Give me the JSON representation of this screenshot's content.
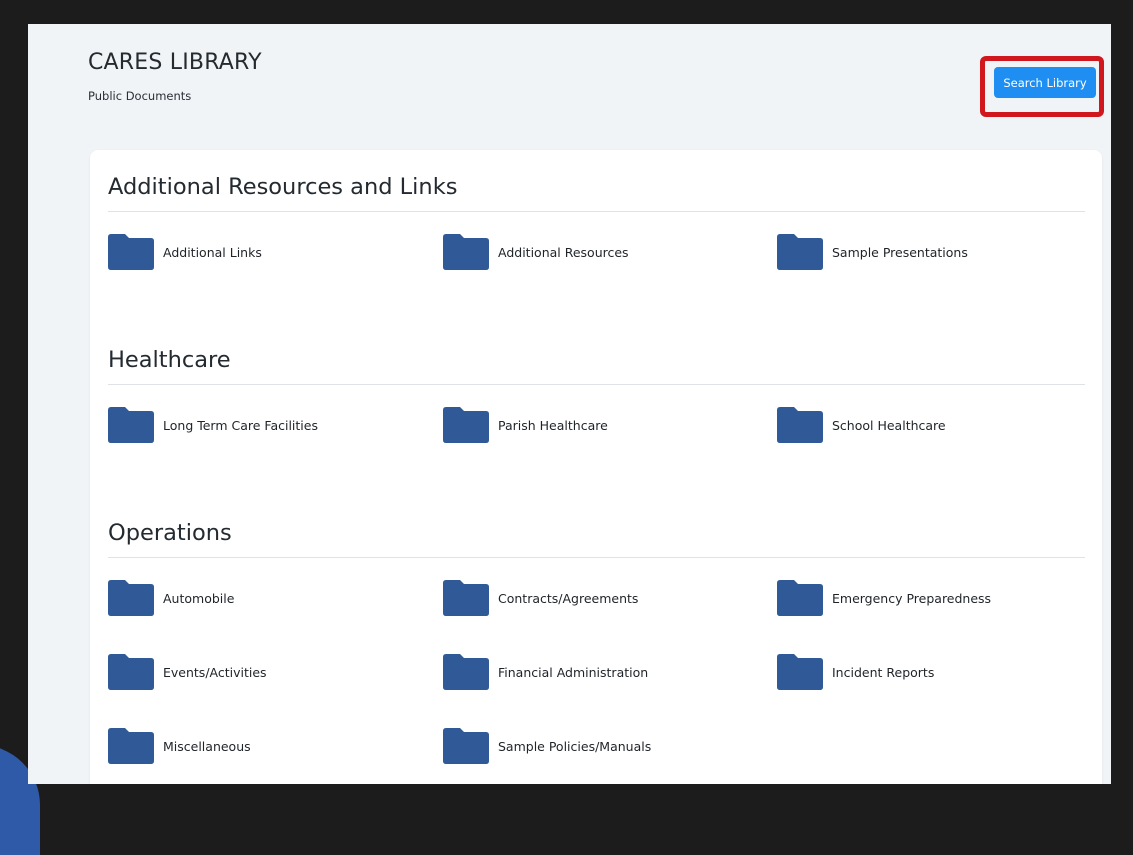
{
  "header": {
    "title": "CARES LIBRARY",
    "subtitle": "Public Documents",
    "search_button": "Search Library"
  },
  "colors": {
    "folder": "#2f5a97",
    "accent_button": "#1e8ef2",
    "highlight": "#d0171d"
  },
  "sections": [
    {
      "heading": "Additional Resources and Links",
      "folders": [
        "Additional Links",
        "Additional Resources",
        "Sample Presentations"
      ]
    },
    {
      "heading": "Healthcare",
      "folders": [
        "Long Term Care Facilities",
        "Parish Healthcare",
        "School Healthcare"
      ]
    },
    {
      "heading": "Operations",
      "folders": [
        "Automobile",
        "Contracts/Agreements",
        "Emergency Preparedness",
        "Events/Activities",
        "Financial Administration",
        "Incident Reports",
        "Miscellaneous",
        "Sample Policies/Manuals"
      ]
    }
  ],
  "folder_icon": "folder-icon"
}
